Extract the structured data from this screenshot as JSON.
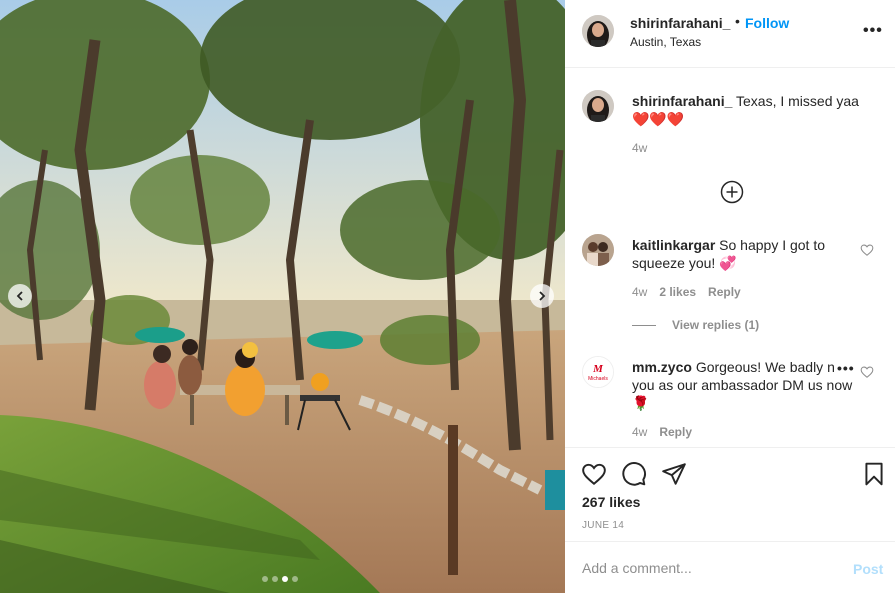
{
  "post": {
    "username": "shirinfarahani_",
    "separator": "•",
    "follow_label": "Follow",
    "location": "Austin, Texas",
    "more_icon": "more-horizontal-icon",
    "carousel": {
      "dot_count": 4,
      "active_dot": 2
    }
  },
  "caption": {
    "username": "shirinfarahani_",
    "text": "Texas, I missed yaa",
    "emoji": "❤️❤️❤️",
    "time": "4w"
  },
  "comments": [
    {
      "username": "kaitlinkargar",
      "text": "So happy I got to squeeze you!",
      "emoji": "💞",
      "time": "4w",
      "likes": "2 likes",
      "reply": "Reply",
      "view_replies": "View replies (1)"
    },
    {
      "username": "mm.zyco",
      "text": "Gorgeous! We badly need you as our ambassador DM us now",
      "emoji": "🌹",
      "time": "4w",
      "reply": "Reply",
      "avatar_text": "Michaels"
    }
  ],
  "actions": {
    "likes": "267 likes",
    "date": "JUNE 14"
  },
  "composer": {
    "placeholder": "Add a comment...",
    "post_label": "Post"
  },
  "colors": {
    "accent": "#0095f6",
    "post_disabled": "#b2dffc",
    "muted": "#8e8e8e",
    "text": "#262626",
    "brand_red": "#d6001c"
  }
}
